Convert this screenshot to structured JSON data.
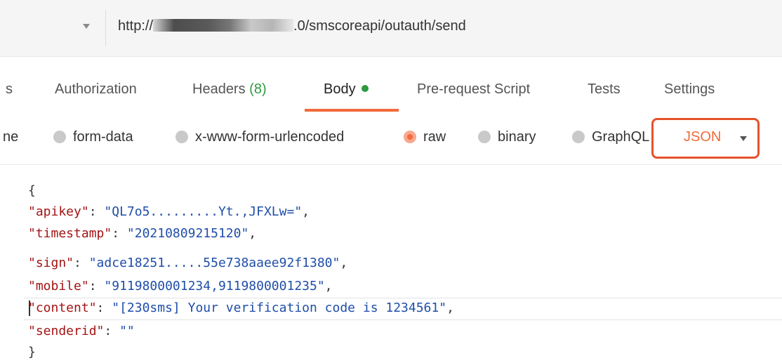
{
  "request": {
    "url_prefix": "http://",
    "url_suffix": ".0/smscoreapi/outauth/send"
  },
  "tabs": [
    {
      "label": "s"
    },
    {
      "label": "Authorization"
    },
    {
      "label": "Headers",
      "count": "(8)"
    },
    {
      "label": "Body"
    },
    {
      "label": "Pre-request Script"
    },
    {
      "label": "Tests"
    },
    {
      "label": "Settings"
    }
  ],
  "body_types": {
    "none": "ne",
    "form_data": "form-data",
    "urlencoded": "x-www-form-urlencoded",
    "raw": "raw",
    "binary": "binary",
    "graphql": "GraphQL",
    "selected": "raw",
    "format": "JSON"
  },
  "editor": {
    "open": "{",
    "close": "}",
    "fields": [
      {
        "key": "\"apikey\"",
        "value": "\"QL7o5.........Yt.,JFXLw=\""
      },
      {
        "key": "\"timestamp\"",
        "value": "\"20210809215120\""
      },
      {
        "key": "\"sign\"",
        "value": "\"adce18251.....55e738aaee92f1380\""
      },
      {
        "key": "\"mobile\"",
        "value": "\"9119800001234,9119800001235\""
      },
      {
        "key": "\"content\"",
        "value": "\"[230sms] Your verification code is 1234561\""
      },
      {
        "key": "\"senderid\"",
        "value": "\"\""
      }
    ]
  },
  "colors": {
    "accent": "#f26b3a",
    "highlight_box": "#e5532d",
    "json_key": "#a31515",
    "json_string": "#1f4ea8",
    "ok_green": "#2e9a3f"
  }
}
